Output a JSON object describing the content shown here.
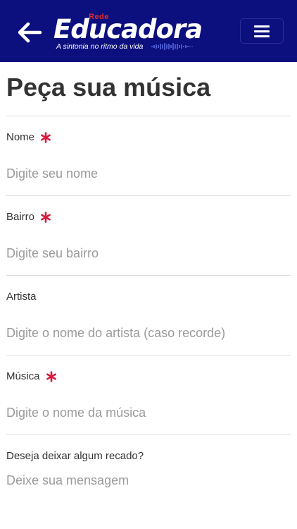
{
  "header": {
    "logo": {
      "prefix": "Rede",
      "name": "Educadora",
      "tagline": "A sintonia no ritmo da vida"
    },
    "icons": {
      "back": "arrow-left-icon",
      "menu": "hamburger-menu-icon"
    },
    "colors": {
      "background": "#0c0f7e",
      "accent_red": "#e32b2b"
    }
  },
  "page": {
    "title": "Peça sua música"
  },
  "form": {
    "required_color": "#d81b3c",
    "fields": [
      {
        "label": "Nome",
        "placeholder": "Digite seu nome",
        "required": true
      },
      {
        "label": "Bairro",
        "placeholder": "Digite seu bairro",
        "required": true
      },
      {
        "label": "Artista",
        "placeholder": "Digite o nome do artista (caso recorde)",
        "required": false
      },
      {
        "label": "Música",
        "placeholder": "Digite o nome da música",
        "required": true
      },
      {
        "label": "Deseja deixar algum recado?",
        "placeholder": "Deixe sua mensagem",
        "required": false
      }
    ]
  }
}
